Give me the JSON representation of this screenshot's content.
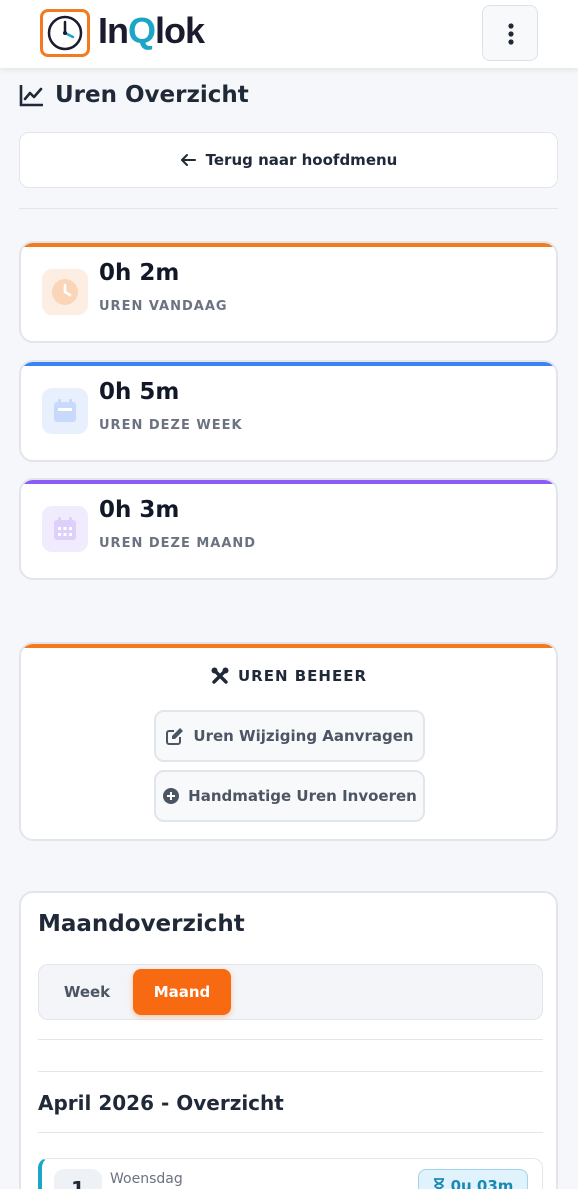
{
  "header": {
    "logo_text_a": "In",
    "logo_text_q": "Q",
    "logo_text_b": "lok"
  },
  "page": {
    "title": "Uren Overzicht",
    "back_label": "Terug naar hoofdmenu"
  },
  "stats": [
    {
      "value": "0h 2m",
      "label": "UREN VANDAAG",
      "accent": "#f47a1f",
      "icon": "clock-icon"
    },
    {
      "value": "0h 5m",
      "label": "UREN DEZE WEEK",
      "accent": "#3b82f6",
      "icon": "calendar-week-icon"
    },
    {
      "value": "0h 3m",
      "label": "UREN DEZE MAAND",
      "accent": "#8b5cf6",
      "icon": "calendar-month-icon"
    }
  ],
  "management": {
    "title": "UREN BEHEER",
    "change_request_label": "Uren Wijziging Aanvragen",
    "manual_entry_label": "Handmatige Uren Invoeren"
  },
  "overview": {
    "title": "Maandoverzicht",
    "toggle_week": "Week",
    "toggle_month": "Maand",
    "selected": "Maand",
    "period_title": "April 2026 - Overzicht",
    "days": [
      {
        "num": "1",
        "name": "Woensdag",
        "badge": "0u 03m"
      }
    ]
  },
  "colors": {
    "brand_orange": "#f47a1f",
    "brand_teal": "#1ba5c7",
    "active_toggle": "#f86a12"
  }
}
